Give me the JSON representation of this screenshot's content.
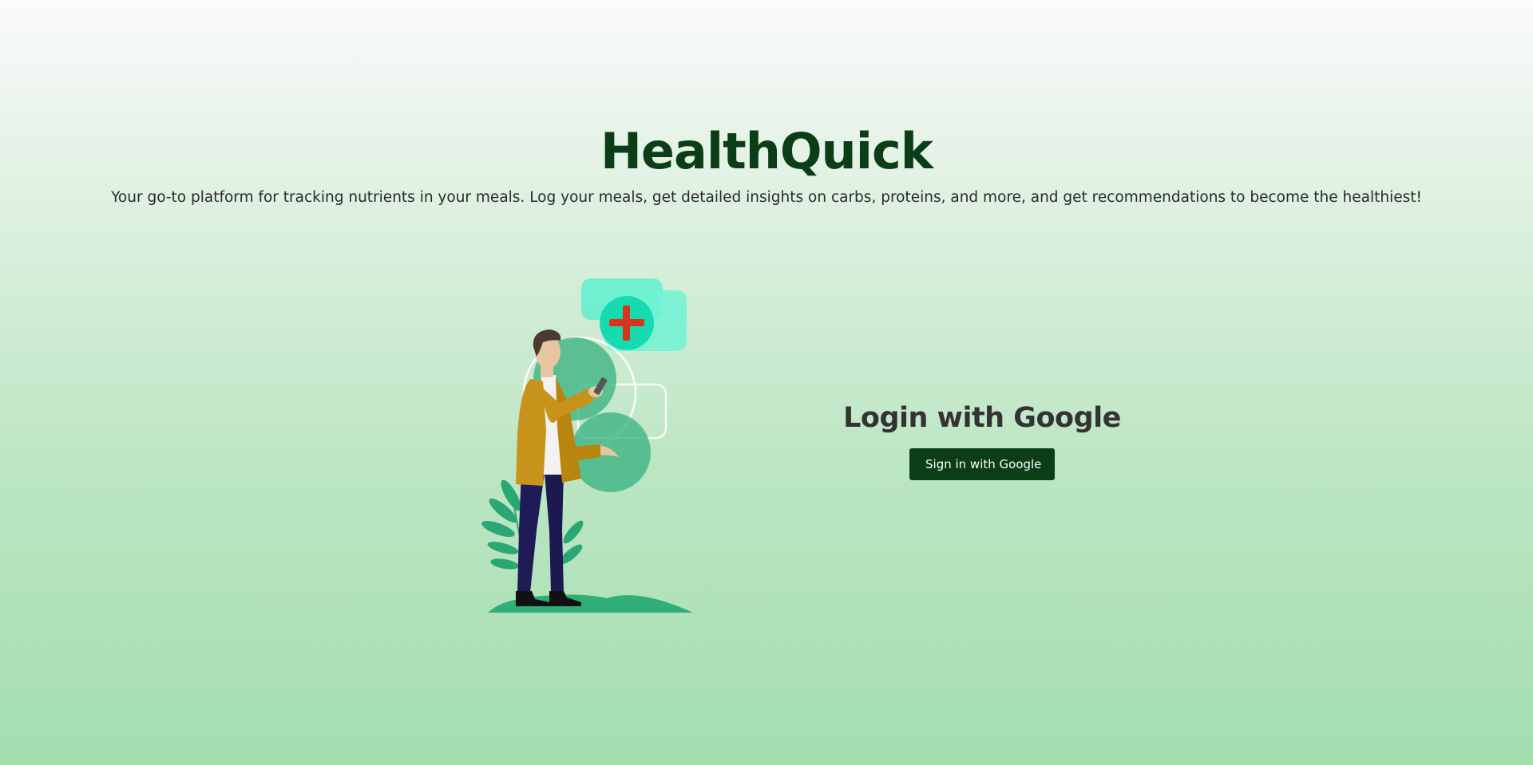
{
  "hero": {
    "title": "HealthQuick",
    "subtitle": "Your go-to platform for tracking nutrients in your meals. Log your meals, get detailed insights on carbs, proteins, and more, and get recommendations to become the healthiest!"
  },
  "login": {
    "heading": "Login with Google",
    "button_label": "Sign in with Google"
  },
  "illustration": {
    "subject": "person-with-phone-and-health-cross",
    "icon": "medical-cross-icon"
  },
  "colors": {
    "brand_dark_green": "#0b3d16",
    "background_top": "#fafbfb",
    "background_bottom": "#a3deae",
    "accent_teal": "#17dbb0",
    "cross_red": "#d7341a",
    "heading_gray": "#333333"
  }
}
